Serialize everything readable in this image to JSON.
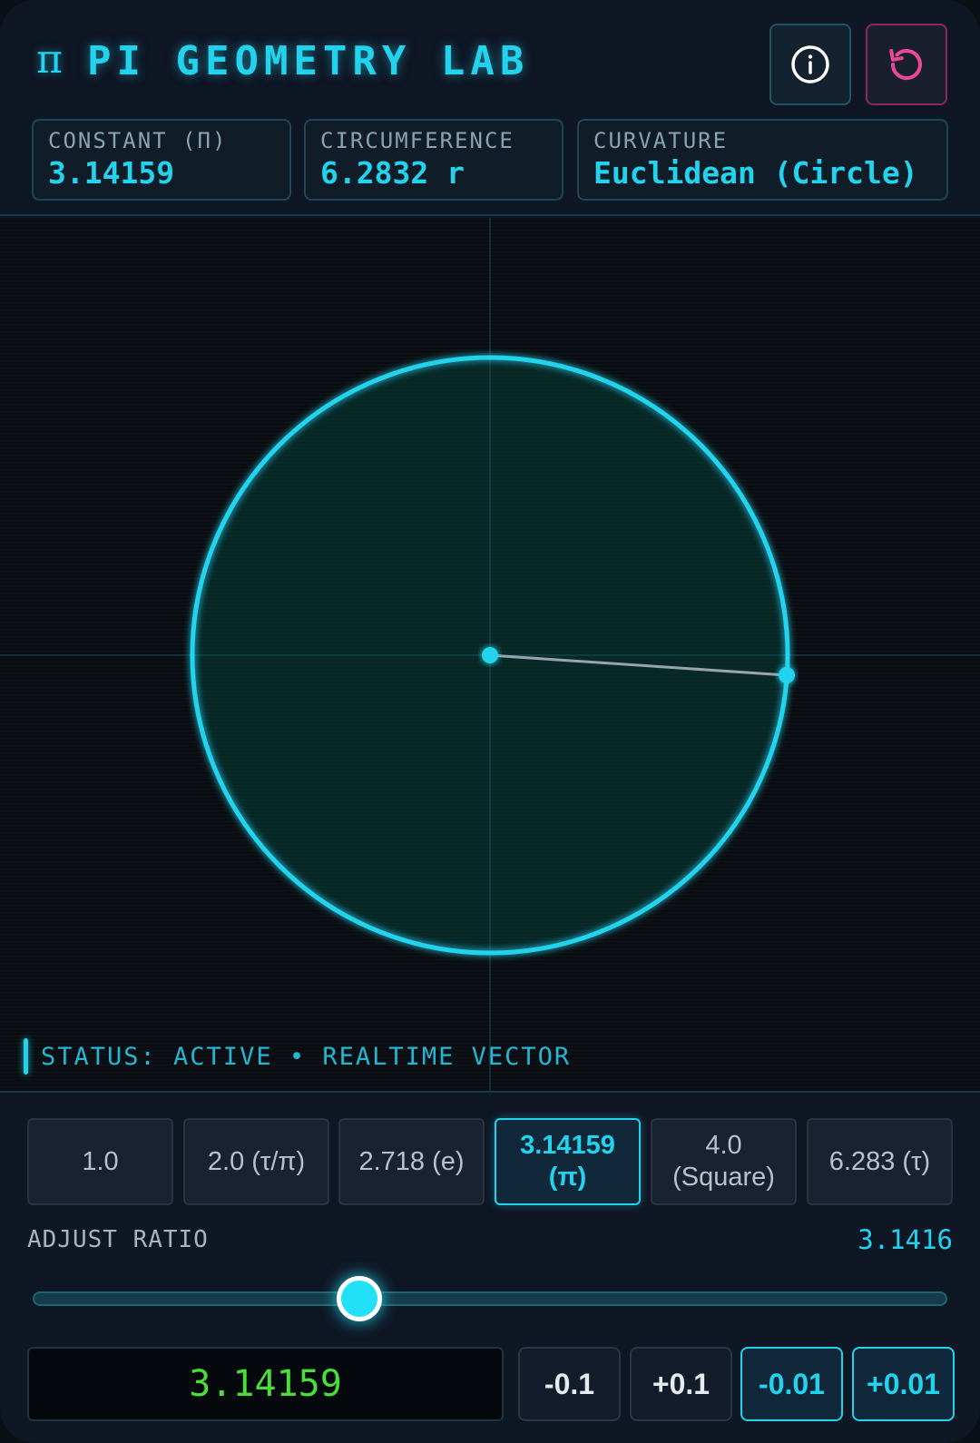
{
  "header": {
    "logo_glyph": "π",
    "title": "PI GEOMETRY LAB",
    "info_icon": "info-circle-icon",
    "reset_icon": "reset-rotate-icon"
  },
  "stats": [
    {
      "label": "CONSTANT (Π)",
      "value": "3.14159"
    },
    {
      "label": "CIRCUMFERENCE",
      "value": "6.2832 r"
    },
    {
      "label": "CURVATURE",
      "value": "Euclidean (Circle)"
    }
  ],
  "canvas": {
    "status": "STATUS: ACTIVE • REALTIME VECTOR"
  },
  "presets": [
    {
      "label": "1.0",
      "active": false
    },
    {
      "label": "2.0 (τ/π)",
      "active": false
    },
    {
      "label": "2.718 (e)",
      "active": false
    },
    {
      "label": "3.14159 (π)",
      "active": true
    },
    {
      "label": "4.0 (Square)",
      "active": false
    },
    {
      "label": "6.283 (τ)",
      "active": false
    }
  ],
  "adjust": {
    "label": "ADJUST RATIO",
    "value": "3.1416",
    "slider_fraction": 0.357,
    "input_value": "3.14159"
  },
  "steps": [
    {
      "label": "-0.1",
      "style": "coarse"
    },
    {
      "label": "+0.1",
      "style": "coarse"
    },
    {
      "label": "-0.01",
      "style": "fine"
    },
    {
      "label": "+0.01",
      "style": "fine"
    }
  ],
  "colors": {
    "accent": "#22d3ee",
    "reset": "#ec4899",
    "input_text": "#4ade3a"
  }
}
